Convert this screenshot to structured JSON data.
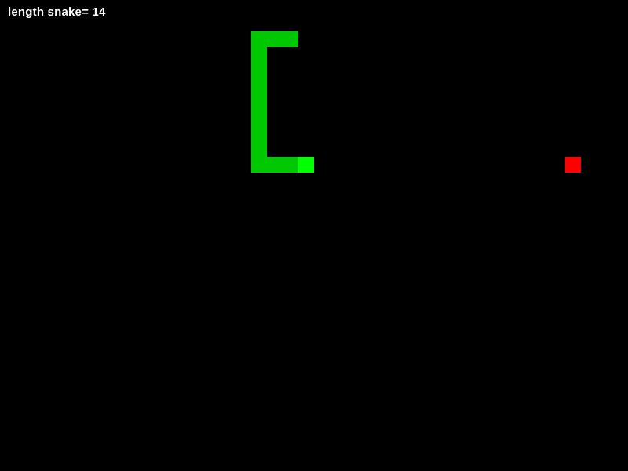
{
  "hud": {
    "score_label": "length snake= 14"
  },
  "game": {
    "grid_cell": 20,
    "colors": {
      "background": "#000000",
      "snake_body": "#00c800",
      "snake_head": "#00ff00",
      "food": "#ff0000",
      "text": "#ffffff"
    },
    "snake": {
      "length": 14,
      "head": {
        "col": 19,
        "row": 10
      },
      "body": [
        {
          "col": 18,
          "row": 2
        },
        {
          "col": 17,
          "row": 2
        },
        {
          "col": 16,
          "row": 2
        },
        {
          "col": 16,
          "row": 3
        },
        {
          "col": 16,
          "row": 4
        },
        {
          "col": 16,
          "row": 5
        },
        {
          "col": 16,
          "row": 6
        },
        {
          "col": 16,
          "row": 7
        },
        {
          "col": 16,
          "row": 8
        },
        {
          "col": 16,
          "row": 9
        },
        {
          "col": 16,
          "row": 10
        },
        {
          "col": 17,
          "row": 10
        },
        {
          "col": 18,
          "row": 10
        }
      ]
    },
    "food": {
      "col": 36,
      "row": 10
    }
  }
}
